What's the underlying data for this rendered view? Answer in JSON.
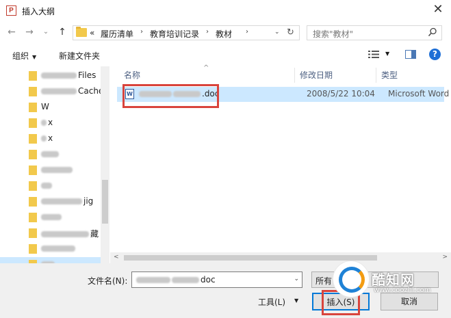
{
  "window": {
    "title": "插入大纲",
    "app_icon_letter": "P",
    "close_glyph": "✕"
  },
  "address": {
    "back_glyph": "←",
    "forward_glyph": "→",
    "history_glyph": "⌄",
    "up_glyph": "↑",
    "overflow": "«",
    "crumbs": [
      "履历清单",
      "教育培训记录",
      "教材"
    ],
    "separator": "›",
    "dropdown_glyph": "⌄",
    "refresh_glyph": "↻"
  },
  "search": {
    "placeholder": "搜索\"教材\""
  },
  "toolbar": {
    "organize": "组织",
    "organize_caret": "▼",
    "new_folder": "新建文件夹",
    "view_caret": "▼",
    "help": "?"
  },
  "nav": {
    "items": [
      {
        "prefix_blur": 52,
        "label": "Files"
      },
      {
        "prefix_blur": 52,
        "label": "Cache"
      },
      {
        "prefix_blur": 0,
        "label": "W"
      },
      {
        "prefix_blur": 8,
        "label": "x"
      },
      {
        "prefix_blur": 8,
        "label": "x"
      },
      {
        "prefix_blur": 26,
        "label": ""
      },
      {
        "prefix_blur": 46,
        "label": ""
      },
      {
        "prefix_blur": 16,
        "label": ""
      },
      {
        "prefix_blur": 60,
        "label": "jig"
      },
      {
        "prefix_blur": 30,
        "label": ""
      },
      {
        "prefix_blur": 70,
        "label": "藏"
      },
      {
        "prefix_blur": 50,
        "label": ""
      },
      {
        "prefix_blur": 20,
        "label": ""
      }
    ],
    "selected_index": 12
  },
  "files": {
    "columns": {
      "name": "名称",
      "modified": "修改日期",
      "type": "类型"
    },
    "sort_glyph": "^",
    "rows": [
      {
        "name_suffix": ".doc",
        "modified": "2008/5/22 10:04",
        "type": "Microsoft Word ..."
      }
    ],
    "icon_letter": "W"
  },
  "scroll": {
    "left_glyph": "<",
    "right_glyph": ">"
  },
  "footer": {
    "filename_label": "文件名(N):",
    "filename_suffix": "doc",
    "filetype_text": "所有",
    "tools_label": "工具(L)",
    "tools_caret": "▼",
    "insert_button": "插入(S)",
    "cancel_button": "取消",
    "dropdown_glyph": "⌄"
  },
  "watermark": {
    "brand": "酷知网",
    "url": "www.coozhi.com"
  },
  "colors": {
    "accent": "#0078d7",
    "selection": "#cce8ff",
    "highlight_box": "#d9443c",
    "folder": "#f2c94c"
  }
}
